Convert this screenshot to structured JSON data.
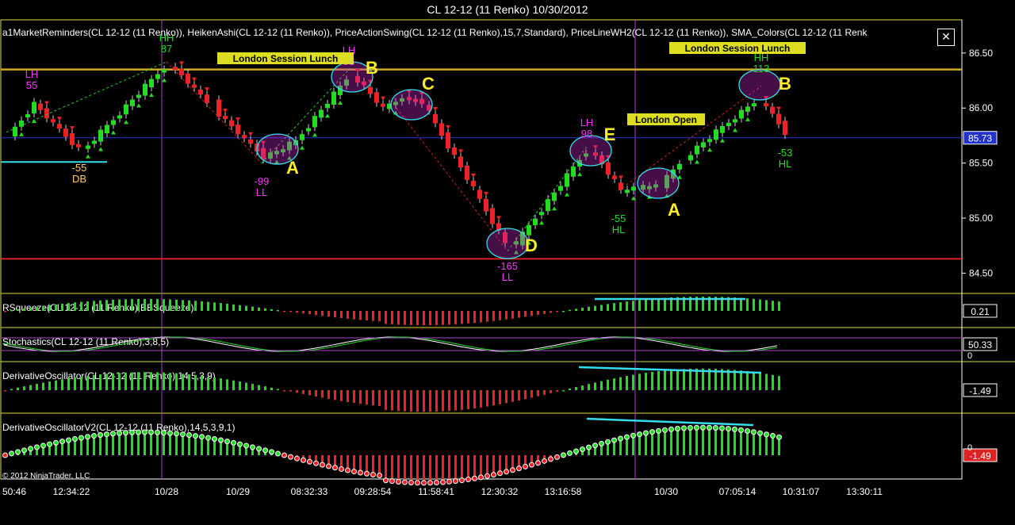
{
  "window": {
    "title": "CL 12-12 (11 Renko)  10/30/2012"
  },
  "indicators_label": "a1MarketReminders(CL 12-12 (11 Renko)), HeikenAshi(CL 12-12 (11 Renko)), PriceActionSwing(CL 12-12 (11 Renko),15,7,Standard), PriceLineWH2(CL 12-12 (11 Renko)), SMA_Colors(CL 12-12 (11 Renk",
  "copyright": "© 2012 NinjaTrader, LLC",
  "colors": {
    "bull": "#22dd22",
    "bear": "#ee2222",
    "accent_yellow": "#ffee22",
    "magenta": "#ff33ff",
    "cyan": "#33ddee",
    "price_tag": "#2233cc",
    "panel_border": "#dddd44",
    "grid_purple": "#aa44cc"
  },
  "chart_data": [
    {
      "type": "candlestick",
      "panel": "price",
      "y_ticks": [
        "86.50",
        "86.00",
        "85.50",
        "85.00",
        "84.50"
      ],
      "ylim": [
        84.33,
        86.78
      ],
      "x_tick_labels": [
        "50:46",
        "12:34:22",
        "10/28",
        "10/29",
        "08:32:33",
        "09:28:54",
        "11:58:41",
        "12:30:32",
        "13:16:58",
        "10/30",
        "07:05:14",
        "10:31:07",
        "13:30:11"
      ],
      "last_price": "85.73",
      "horizontal_lines": {
        "resistance": 86.35,
        "support": 84.63,
        "last_price": 85.73
      },
      "session_markers": [
        "London Session Lunch",
        "London Open",
        "London Session Lunch"
      ],
      "pattern_labels": [
        "A",
        "B",
        "C",
        "D",
        "E",
        "A",
        "B"
      ],
      "swing_labels": [
        {
          "label": "LH",
          "value": "55"
        },
        {
          "label": "HH",
          "value": "87"
        },
        {
          "label": "DB",
          "value": "-55"
        },
        {
          "label": "LL",
          "value": "-99"
        },
        {
          "label": "LH",
          "value": "98"
        },
        {
          "label": "LL",
          "value": "-165"
        },
        {
          "label": "LH",
          "value": "98"
        },
        {
          "label": "HL",
          "value": "-55"
        },
        {
          "label": "HH",
          "value": "113"
        },
        {
          "label": "HL",
          "value": "-53"
        }
      ]
    },
    {
      "type": "bar",
      "panel": "squeeze",
      "title": "RSqueeze(CL 12-12 (11 Renko),BBSqueeze)",
      "last_value": "0.21"
    },
    {
      "type": "line",
      "panel": "stochastics",
      "title": "Stochastics(CL 12-12 (11 Renko),3,8,5)",
      "last_value": "50.33",
      "level_label": "0"
    },
    {
      "type": "bar",
      "panel": "derivative_oscillator",
      "title": "DerivativeOscillator(CL 12-12 (11 Renko),14,5,3,9)",
      "last_value": "-1.49"
    },
    {
      "type": "bar",
      "panel": "derivative_oscillator_v2",
      "title": "DerivativeOscillatorV2(CL 12-12 (11 Renko),14,5,3,9,1)",
      "last_value": "-1.49",
      "level_label": "0"
    }
  ]
}
